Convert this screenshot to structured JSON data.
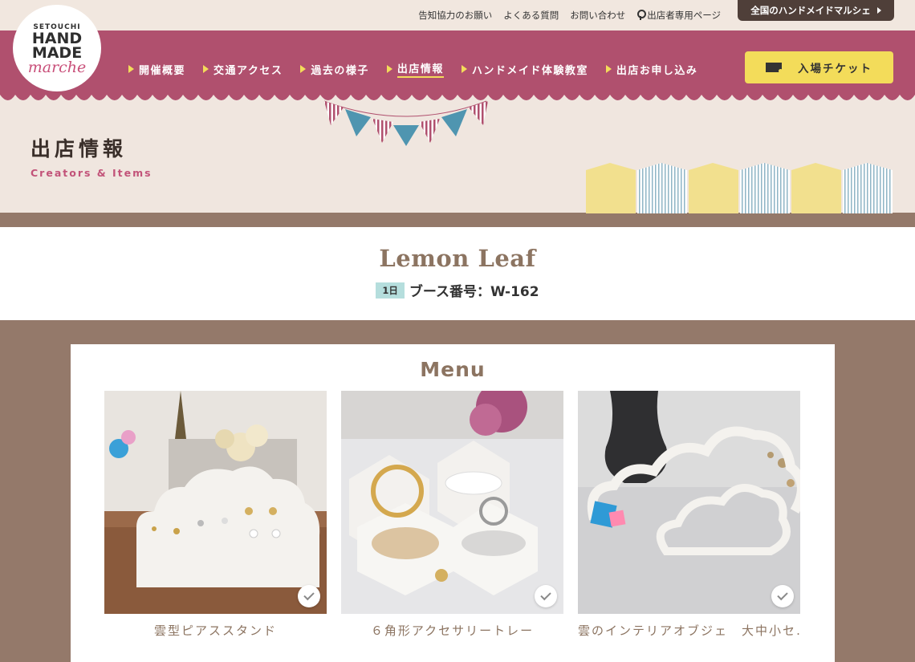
{
  "top_links": [
    "告知協力のお願い",
    "よくある質問",
    "お問い合わせ",
    "出店者専用ページ"
  ],
  "national_button": "全国のハンドメイドマルシェ",
  "logo": {
    "line1": "SETOUCHI",
    "line2": "HAND",
    "line3": "MADE",
    "line4": "marche"
  },
  "nav": [
    {
      "label": "開催概要"
    },
    {
      "label": "交通アクセス"
    },
    {
      "label": "過去の様子"
    },
    {
      "label": "出店情報",
      "active": true
    },
    {
      "label": "ハンドメイド体験教室"
    },
    {
      "label": "出店お申し込み"
    }
  ],
  "ticket_button": "入場チケット",
  "page": {
    "title": "出店情報",
    "subtitle": "Creators & Items"
  },
  "creator": {
    "name": "Lemon Leaf",
    "day": "1日",
    "booth": "ブース番号：W-162"
  },
  "menu": {
    "title": "Menu",
    "items": [
      {
        "label": "雲型ピアススタンド",
        "icon": "check-icon"
      },
      {
        "label": "６角形アクセサリートレー",
        "icon": "check-icon"
      },
      {
        "label": "雲のインテリアオブジェ　大中小セ…",
        "icon": "check-icon"
      }
    ]
  },
  "colors": {
    "header": "#b0506e",
    "accent": "#f3dc5a",
    "brown": "#94796a",
    "title_band": "#f0e6df"
  }
}
